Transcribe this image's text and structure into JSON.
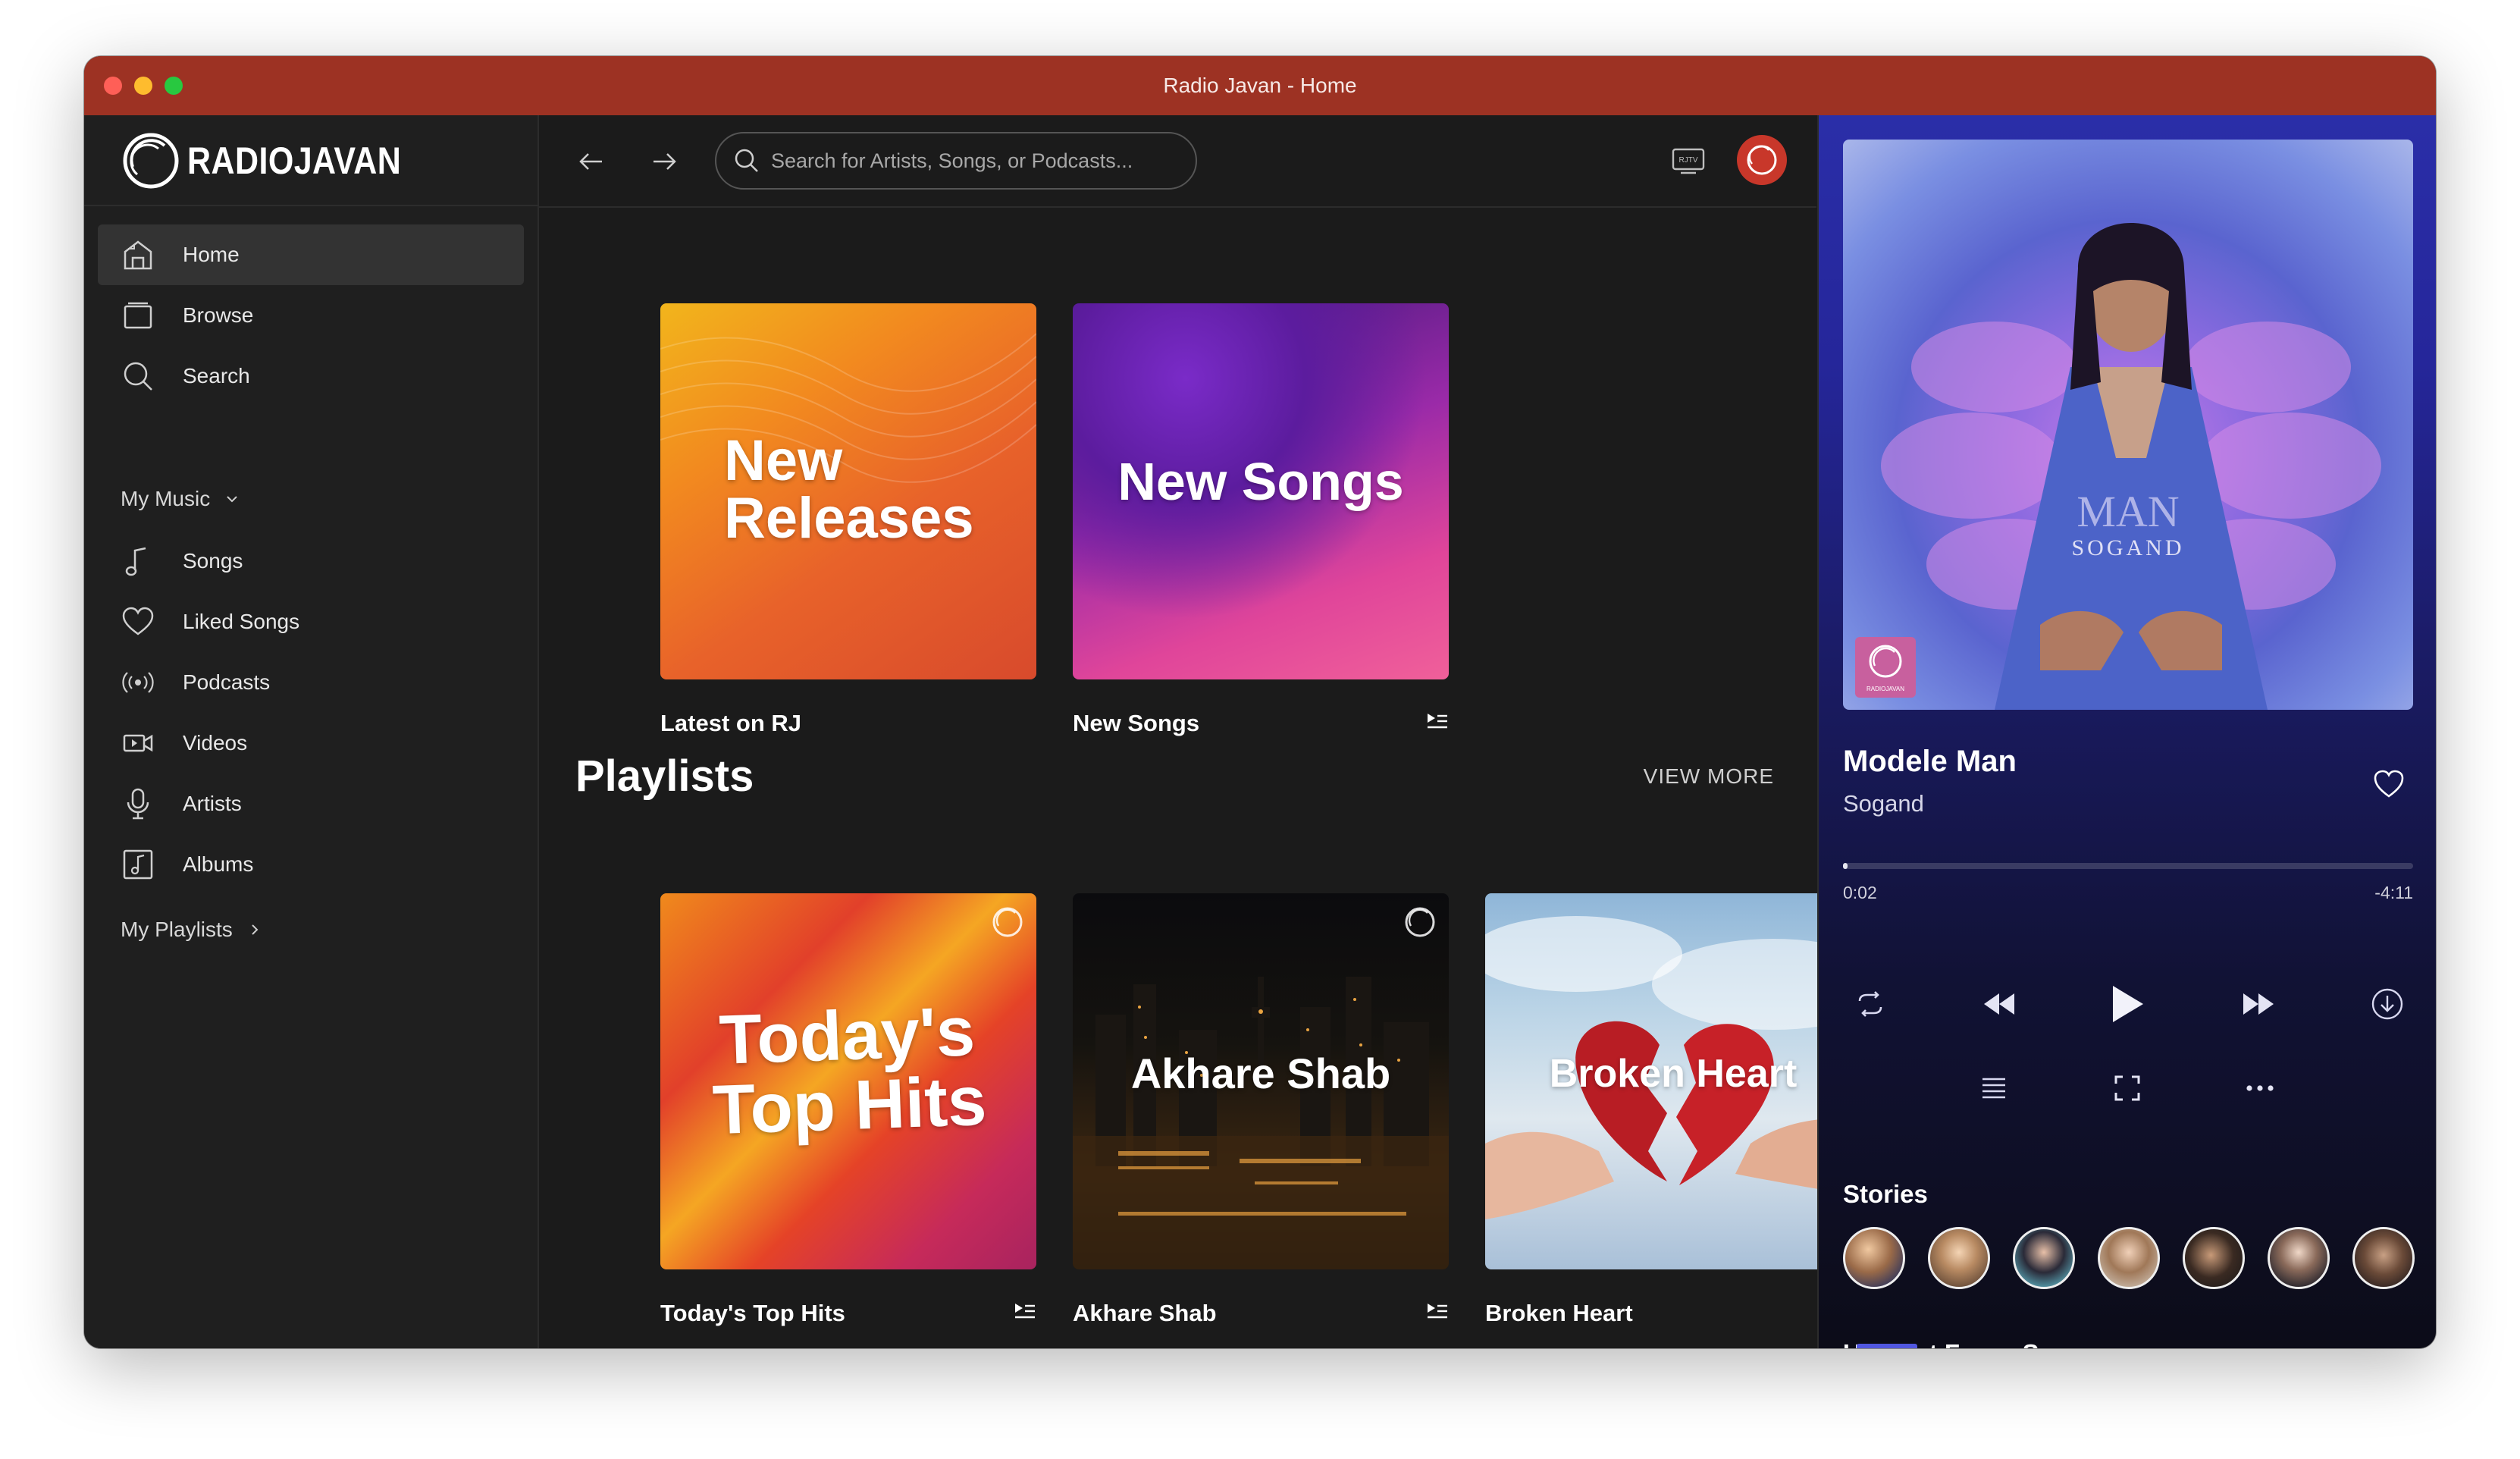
{
  "window": {
    "title": "Radio Javan - Home"
  },
  "brand": {
    "logo_text": "RADIOJAVAN"
  },
  "sidebar": {
    "primary": [
      {
        "label": "Home",
        "icon": "home-icon",
        "active": true
      },
      {
        "label": "Browse",
        "icon": "browse-icon",
        "active": false
      },
      {
        "label": "Search",
        "icon": "search-icon",
        "active": false
      }
    ],
    "my_music": {
      "label": "My Music",
      "items": [
        {
          "label": "Songs",
          "icon": "music-note-icon"
        },
        {
          "label": "Liked Songs",
          "icon": "heart-icon"
        },
        {
          "label": "Podcasts",
          "icon": "podcast-icon"
        },
        {
          "label": "Videos",
          "icon": "video-icon"
        },
        {
          "label": "Artists",
          "icon": "microphone-icon"
        },
        {
          "label": "Albums",
          "icon": "album-icon"
        }
      ]
    },
    "my_playlists": {
      "label": "My Playlists"
    }
  },
  "topbar": {
    "search_placeholder": "Search for Artists, Songs, or Podcasts...",
    "tv_label": "RJTV"
  },
  "featured": [
    {
      "cover_text_1": "New",
      "cover_text_2": "Releases",
      "label": "Latest on RJ",
      "has_queue": false
    },
    {
      "cover_text_1": "New Songs",
      "label": "New Songs",
      "has_queue": true
    }
  ],
  "playlists": {
    "title": "Playlists",
    "view_more": "VIEW MORE",
    "items": [
      {
        "cover_text_1": "Today's",
        "cover_text_2": "Top Hits",
        "label": "Today's Top Hits"
      },
      {
        "cover_text_1": "Akhare Shab",
        "label": "Akhare Shab"
      },
      {
        "cover_text_1": "Broken Heart",
        "label": "Broken Heart"
      }
    ]
  },
  "player": {
    "album_text_1": "MAN",
    "album_text_2": "SOGAND",
    "album_badge": "RADIOJAVAN",
    "song_title": "Modele Man",
    "artist": "Sogand",
    "elapsed": "0:02",
    "remaining": "-4:11",
    "progress": 0.008,
    "stories_title": "Stories",
    "story_count": 7,
    "up_next_prefix": "Up Next From: ",
    "up_next_source": "Songs"
  },
  "colors": {
    "titlebar": "#9d3223",
    "sidebar_bg": "#1f1f1f",
    "main_bg": "#1b1b1b",
    "player_top": "#2a2ea8",
    "accent": "#c8372a"
  }
}
